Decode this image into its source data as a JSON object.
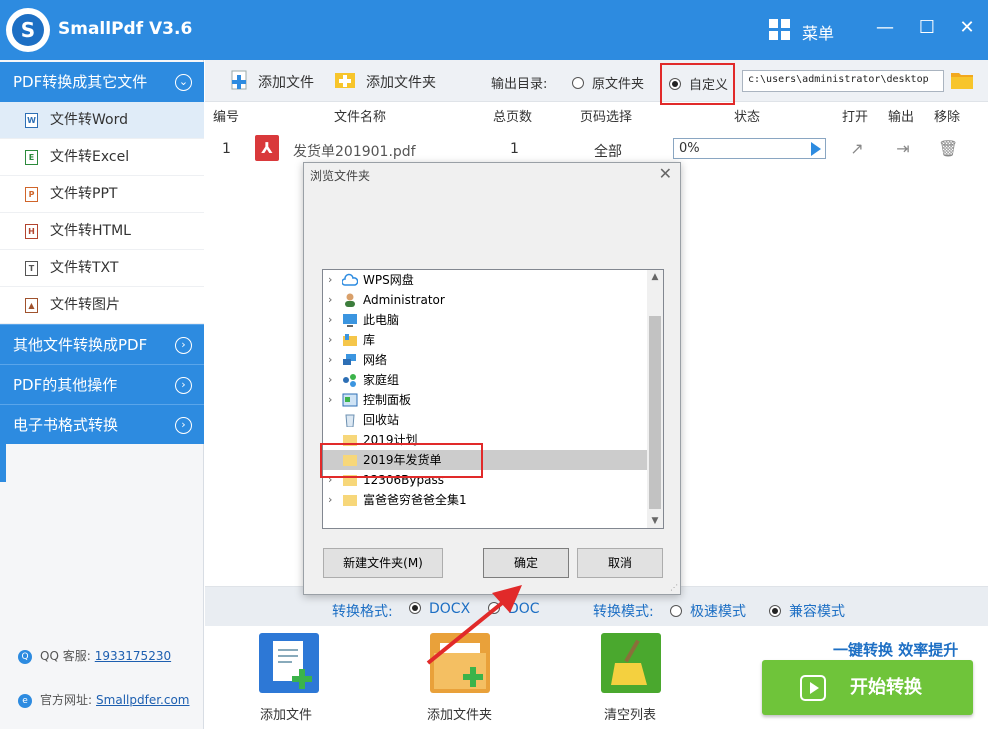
{
  "app": {
    "title": "SmallPdf V3.6",
    "logo_letter": "S",
    "menu_label": "菜单"
  },
  "window_buttons": {
    "minimize": "—",
    "maximize": "☐",
    "close": "✕"
  },
  "sidebar": {
    "category_main": "PDF转换成其它文件",
    "items": [
      {
        "label": "文件转Word",
        "icon_letter": "W"
      },
      {
        "label": "文件转Excel",
        "icon_letter": "E"
      },
      {
        "label": "文件转PPT",
        "icon_letter": "P"
      },
      {
        "label": "文件转HTML",
        "icon_letter": "H"
      },
      {
        "label": "文件转TXT",
        "icon_letter": "T"
      },
      {
        "label": "文件转图片",
        "icon_letter": "▲"
      }
    ],
    "categories": [
      "其他文件转换成PDF",
      "PDF的其他操作",
      "电子书格式转换"
    ],
    "qq_label": "QQ 客服:",
    "qq_value": "1933175230",
    "site_label": "官方网址:",
    "site_value": "Smallpdfer.com"
  },
  "toolbar": {
    "add_file": "添加文件",
    "add_folder": "添加文件夹",
    "output_label": "输出目录:",
    "radio_original": "原文件夹",
    "radio_custom": "自定义",
    "path_value": "c:\\users\\administrator\\desktop"
  },
  "table": {
    "headers": [
      "编号",
      "文件名称",
      "总页数",
      "页码选择",
      "状态",
      "打开",
      "输出",
      "移除"
    ],
    "rows": [
      {
        "index": "1",
        "name": "发货单201901.pdf",
        "pages": "1",
        "range": "全部",
        "progress": "0%"
      }
    ]
  },
  "options": {
    "format_label": "转换格式:",
    "format_docx": "DOCX",
    "format_doc": "DOC",
    "mode_label": "转换模式:",
    "mode_fast": "极速模式",
    "mode_compat": "兼容模式"
  },
  "bottom": {
    "add_file": "添加文件",
    "add_folder": "添加文件夹",
    "clear_list": "清空列表",
    "slogan": "一键转换  效率提升",
    "start": "开始转换"
  },
  "dialog": {
    "title": "浏览文件夹",
    "tree": [
      "WPS网盘",
      "Administrator",
      "此电脑",
      "库",
      "网络",
      "家庭组",
      "控制面板",
      "回收站",
      "2019计划",
      "2019年发货单",
      "12306Bypass",
      "富爸爸穷爸爸全集1"
    ],
    "new_folder": "新建文件夹(M)",
    "ok": "确定",
    "cancel": "取消"
  },
  "colors": {
    "brand_blue": "#2d8be0",
    "highlight_red": "#e12a2a",
    "start_green": "#6fc43a"
  }
}
